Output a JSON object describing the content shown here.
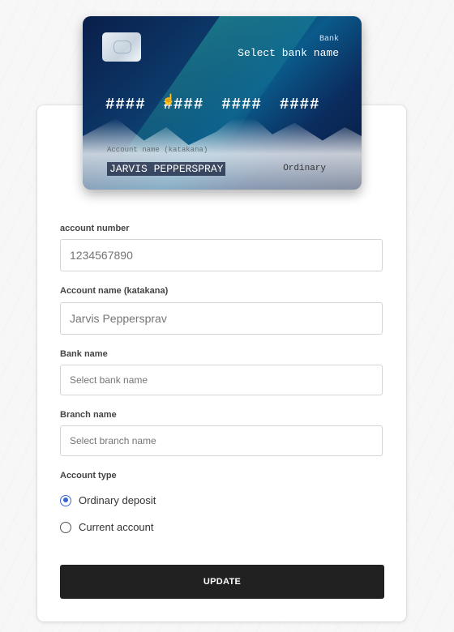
{
  "card": {
    "bank_label": "Bank",
    "bank_name": "Select bank name",
    "number_groups": [
      "####",
      "####",
      "####",
      "####"
    ],
    "holder_label": "Account name (katakana)",
    "holder_name": "JARVIS PEPPERSPRAY",
    "account_type": "Ordinary"
  },
  "form": {
    "account_number": {
      "label": "account number",
      "placeholder": "1234567890"
    },
    "account_name": {
      "label": "Account name (katakana)",
      "placeholder": "Jarvis Peppersprav"
    },
    "bank_name": {
      "label": "Bank name",
      "placeholder": "Select bank name"
    },
    "branch_name": {
      "label": "Branch name",
      "placeholder": "Select branch name"
    },
    "account_type": {
      "label": "Account type",
      "options": [
        {
          "label": "Ordinary deposit",
          "selected": true
        },
        {
          "label": "Current account",
          "selected": false
        }
      ]
    },
    "update_label": "UPDATE"
  },
  "colors": {
    "accent": "#3a66d4",
    "button": "#212121"
  }
}
